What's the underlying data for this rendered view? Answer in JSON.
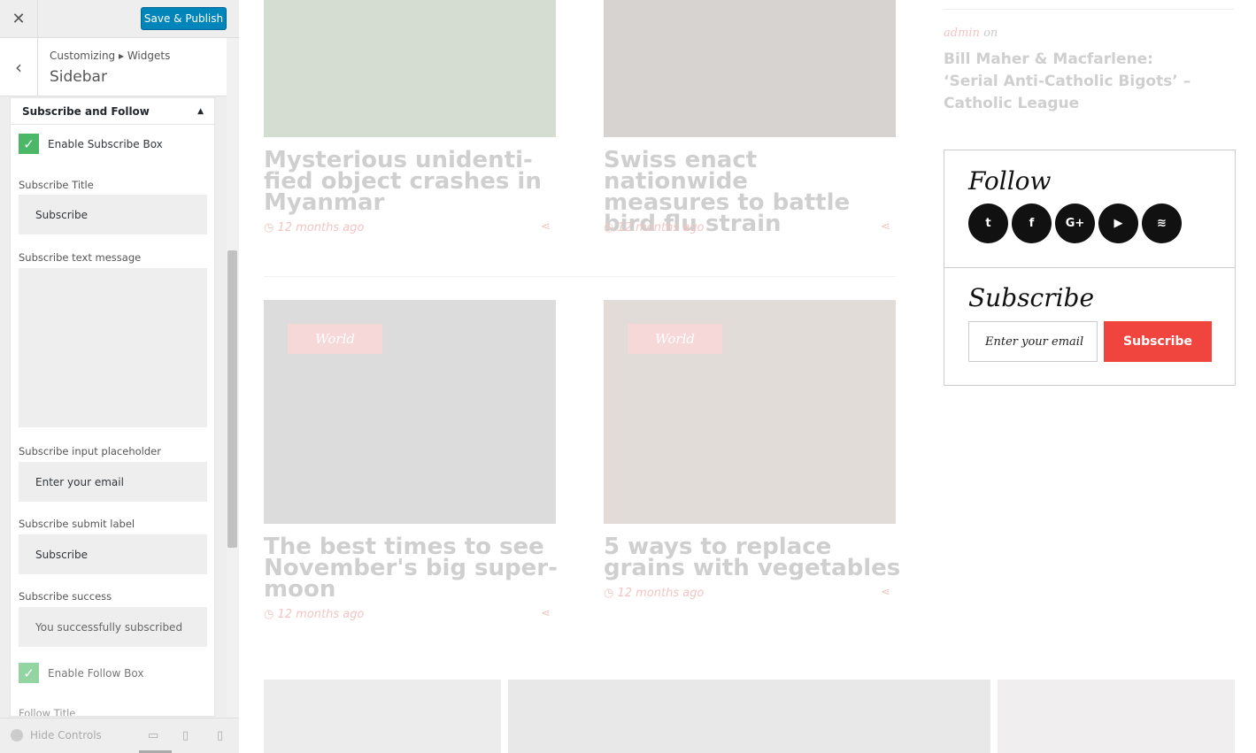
{
  "toolbar": {
    "close_icon": "close-icon",
    "publish_label": "Save & Publish"
  },
  "header": {
    "breadcrumb": "Customizing ▸ Widgets",
    "title": "Sidebar"
  },
  "widget": {
    "title": "Subscribe and Follow",
    "enable_subscribe_label": "Enable Subscribe Box",
    "subscribe_title_label": "Subscribe Title",
    "subscribe_title_value": "Subscribe",
    "subscribe_text_label": "Subscribe text message",
    "subscribe_text_value": "",
    "placeholder_label": "Subscribe input placeholder",
    "placeholder_value": "Enter your email",
    "submit_label_label": "Subscribe submit label",
    "submit_label_value": "Subscribe",
    "success_label": "Subscribe success",
    "success_value": "You successfully subscribed",
    "enable_follow_label": "Enable Follow Box",
    "follow_title_label": "Follow Title"
  },
  "footer": {
    "hide_controls": "Hide Controls"
  },
  "preview": {
    "posts": [
      {
        "title": "Mysterious unidenti-\nfied object crashes in\nMyanmar",
        "time": "12 months ago"
      },
      {
        "title": "Swiss enact nationwide\nmeasures to battle\nbird flu strain",
        "time": "12 months ago"
      },
      {
        "title": "The best times to see\nNovember's big super-\nmoon",
        "time": "12 months ago",
        "tag": "World"
      },
      {
        "title": "5 ways to replace\ngrains with vegetables",
        "time": "12 months ago",
        "tag": "World"
      }
    ],
    "recent": {
      "author": "admin",
      "on": "on",
      "title": "Bill Maher & Macfarlene: ‘Serial Anti-Catholic Bigots’ – Catholic League"
    },
    "follow_title": "Follow",
    "subscribe_title": "Subscribe",
    "email_placeholder": "Enter your email",
    "subscribe_button": "Subscribe",
    "social": [
      "twitter-icon",
      "facebook-icon",
      "google-plus-icon",
      "youtube-icon",
      "rss-icon"
    ]
  }
}
